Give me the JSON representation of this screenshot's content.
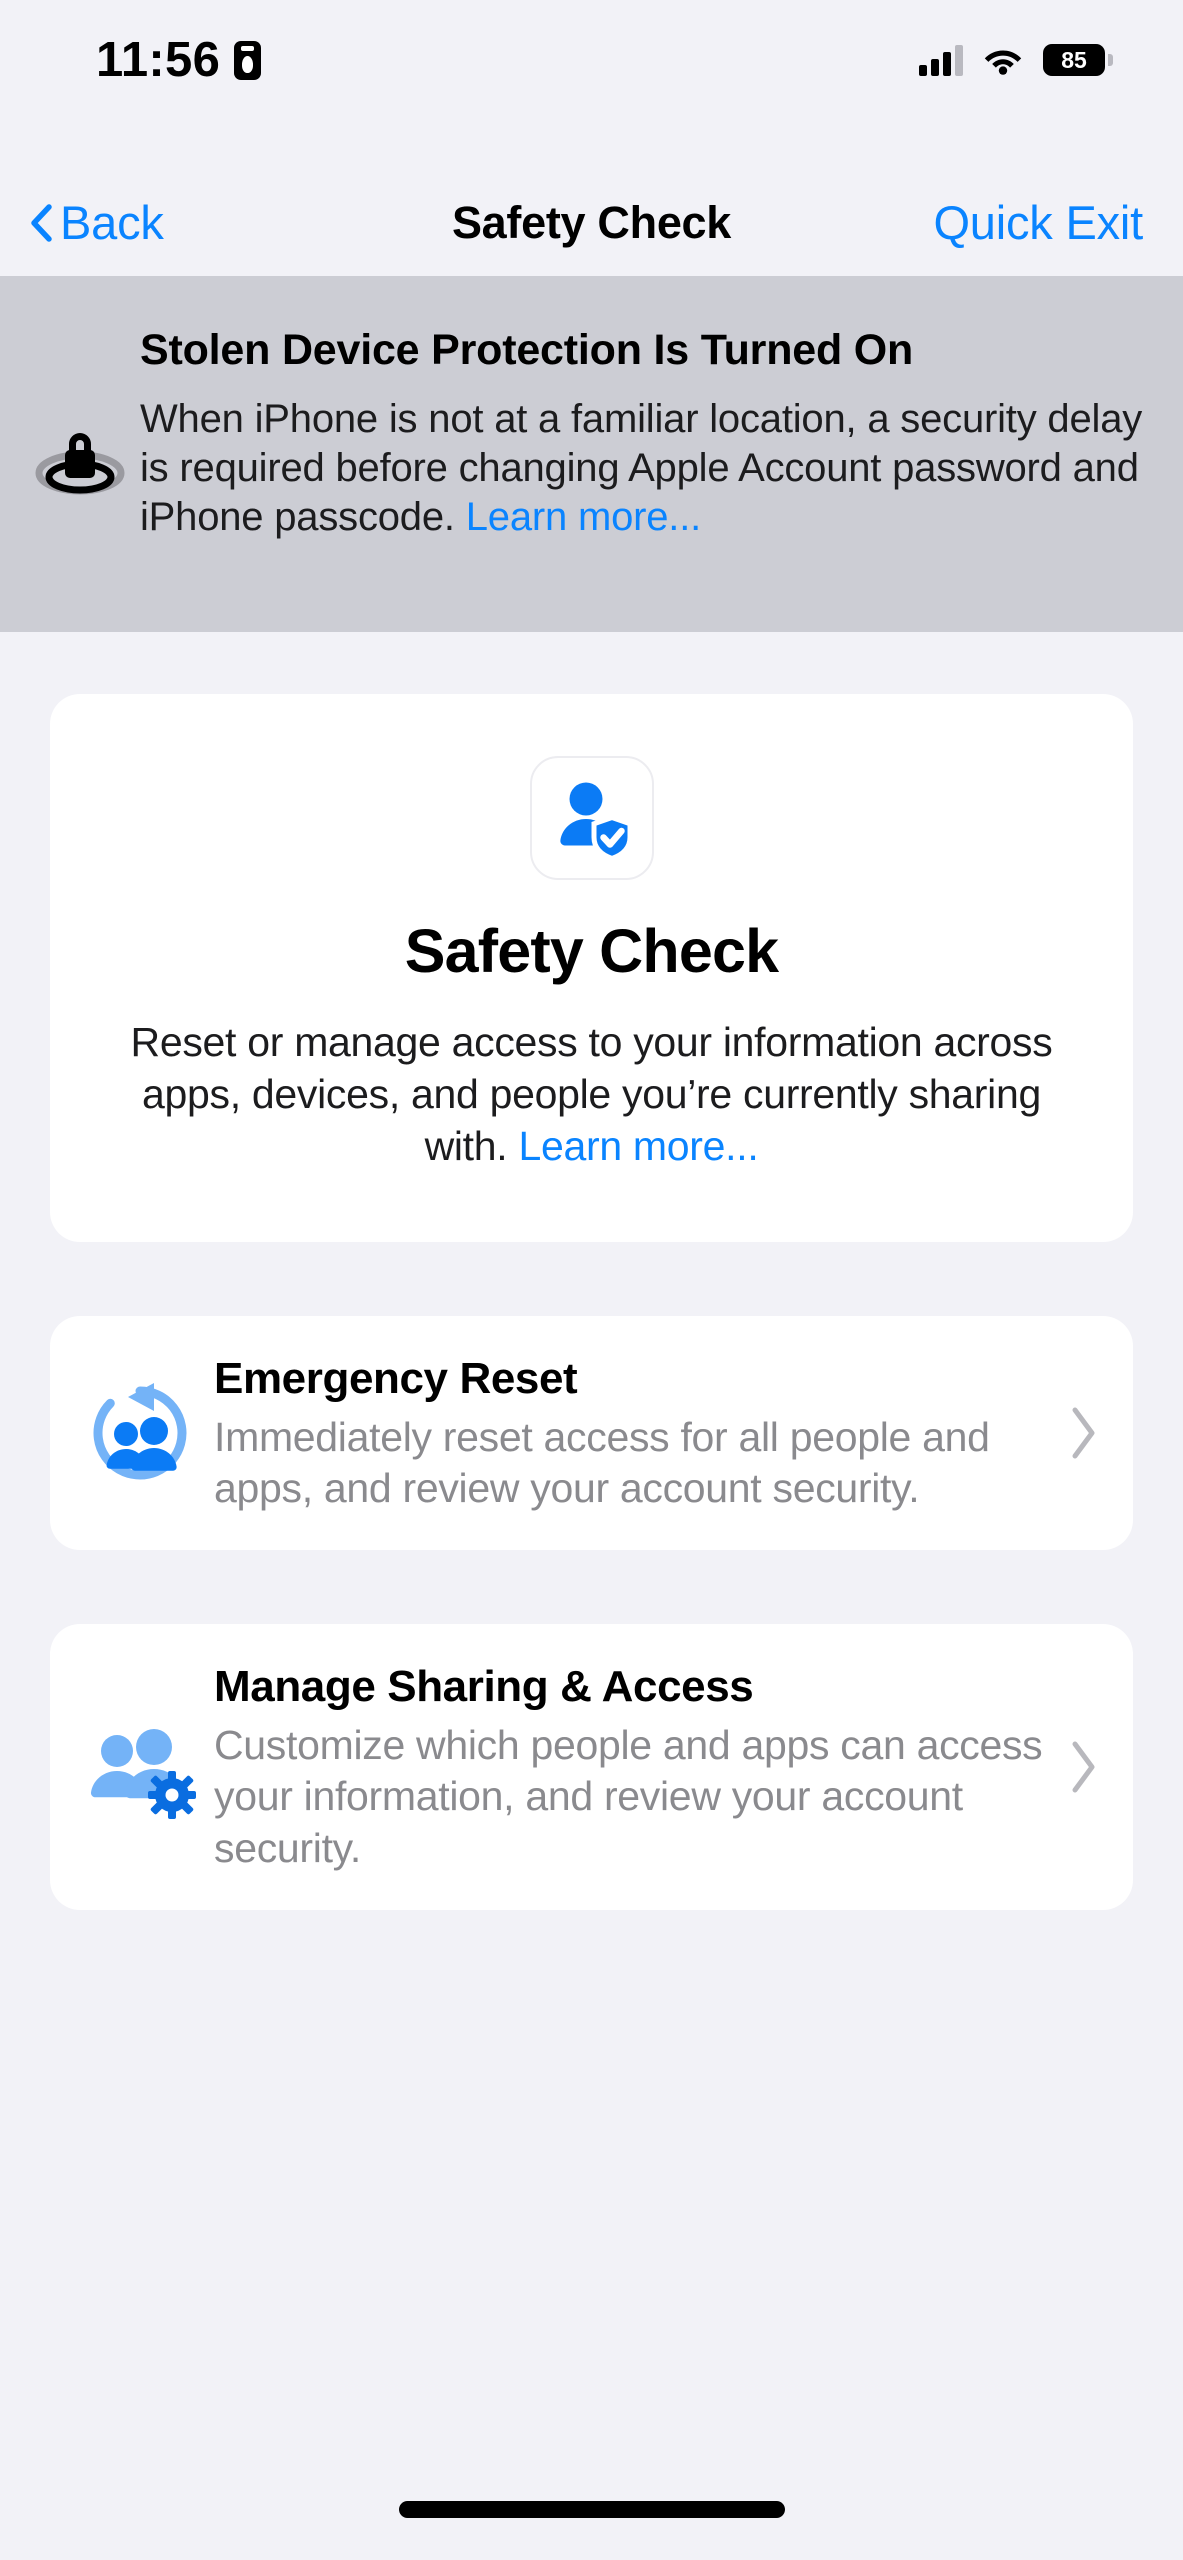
{
  "status_bar": {
    "time": "11:56",
    "recording_icon": "privacy-record-icon",
    "signal_icon": "cellular-signal-icon",
    "wifi_icon": "wifi-icon",
    "battery_level": "85"
  },
  "nav": {
    "back_label": "Back",
    "back_icon": "chevron-left-icon",
    "title": "Safety Check",
    "quick_exit_label": "Quick Exit"
  },
  "banner": {
    "icon": "lock-on-location-icon",
    "title": "Stolen Device Protection Is Turned On",
    "body": "When iPhone is not at a familiar location, a security delay is required before changing Apple Account password and iPhone passcode.",
    "link_label": "Learn more...",
    "background_color": "#cccdd4"
  },
  "hero": {
    "icon": "person-with-shield-check-icon",
    "title": "Safety Check",
    "description": "Reset or manage access to your information across apps, devices, and people you’re currently sharing with.",
    "link_label": "Learn more..."
  },
  "rows": [
    {
      "icon": "people-reset-arrow-icon",
      "title": "Emergency Reset",
      "subtitle": "Immediately reset access for all people and apps, and review your account security.",
      "chevron": "chevron-right-icon"
    },
    {
      "icon": "people-gear-icon",
      "title": "Manage Sharing & Access",
      "subtitle": "Customize which people and apps can access your information, and review your account security.",
      "chevron": "chevron-right-icon"
    }
  ],
  "colors": {
    "accent_blue": "#0a84ff",
    "icon_blue": "#0b7bf5",
    "icon_light_blue": "#74b3f7",
    "page_background": "#f2f2f7",
    "card_background": "#ffffff",
    "subtitle_gray": "#8a8a8e"
  },
  "home_indicator": "home-indicator-bar"
}
